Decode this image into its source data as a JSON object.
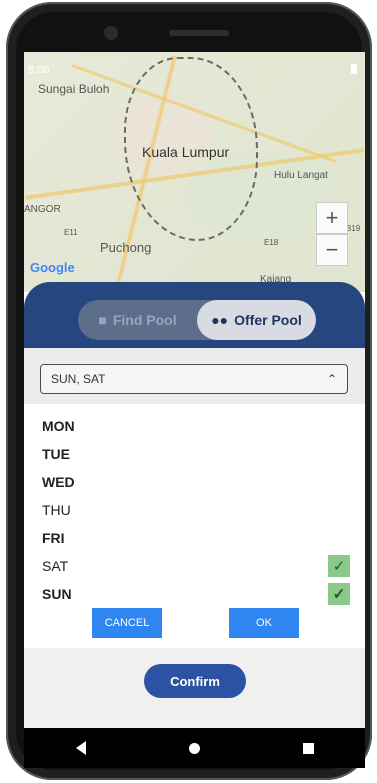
{
  "status_bar": {
    "time": "8:00"
  },
  "map": {
    "labels": [
      "Sungai Buloh",
      "Kuala Lumpur",
      "Hulu Langat",
      "ANGOR",
      "Puchong",
      "Kajang",
      "E11",
      "E18",
      "B19"
    ],
    "attribution": "Google",
    "zoom_in": "+",
    "zoom_out": "−"
  },
  "mode_toggle": {
    "find_label": "Find Pool",
    "offer_label": "Offer Pool",
    "selected": "Offer Pool"
  },
  "day_select": {
    "value": "SUN, SAT",
    "options": [
      {
        "label": "MON",
        "checked": false
      },
      {
        "label": "TUE",
        "checked": false
      },
      {
        "label": "WED",
        "checked": false
      },
      {
        "label": "THU",
        "checked": false
      },
      {
        "label": "FRI",
        "checked": false
      },
      {
        "label": "SAT",
        "checked": true
      },
      {
        "label": "SUN",
        "checked": true
      }
    ],
    "cancel_label": "CANCEL",
    "ok_label": "OK"
  },
  "confirm_label": "Confirm",
  "colors": {
    "header": "#25467f",
    "accent": "#2f86f0",
    "confirm": "#2b52a3",
    "check": "#8bc98b"
  }
}
